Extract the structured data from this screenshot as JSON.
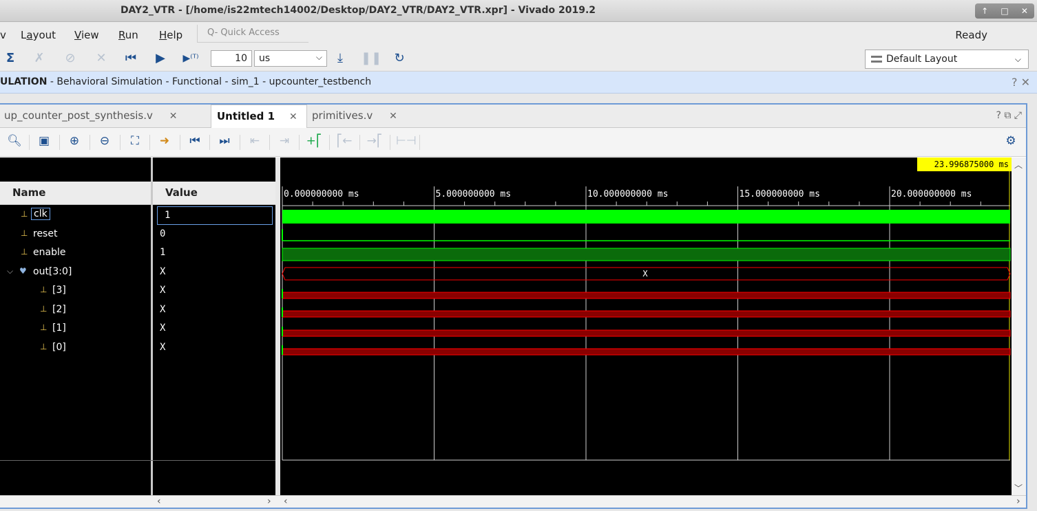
{
  "window": {
    "title": "DAY2_VTR - [/home/is22mtech14002/Desktop/DAY2_VTR/DAY2_VTR.xpr] - Vivado 2019.2",
    "controls": [
      "↑",
      "□",
      "✕"
    ]
  },
  "menu": {
    "items": [
      {
        "label": "Layout",
        "u": "a",
        "pre": "L",
        "post": "yout"
      },
      {
        "label": "View",
        "u": "V",
        "pre": "",
        "post": "iew"
      },
      {
        "label": "Run",
        "u": "R",
        "pre": "",
        "post": "un"
      },
      {
        "label": "Help",
        "u": "H",
        "pre": "",
        "post": "elp"
      }
    ],
    "quick_access": "Q- Quick Access",
    "status": "Ready",
    "partial_left": "v"
  },
  "toolbar": {
    "run_time": "10",
    "run_unit": "us",
    "layout": "Default Layout",
    "icons": [
      "sigma-icon",
      "step-back-icon",
      "run-all-icon",
      "run-for-icon",
      "restart-icon"
    ]
  },
  "sim_bar": {
    "title_bold": "ULATION",
    "title_rest": " - Behavioral Simulation - Functional - sim_1 - upcounter_testbench",
    "controls": "? ✕"
  },
  "tabs": [
    {
      "label": "up_counter_post_synthesis.v",
      "active": false
    },
    {
      "label": "Untitled 1",
      "active": true
    },
    {
      "label": "primitives.v",
      "active": false
    }
  ],
  "tab_controls": "?  ⧉  ⤢",
  "waveform": {
    "cursor_time": "23.996875000 ms",
    "headers": {
      "name": "Name",
      "value": "Value"
    },
    "time_axis": {
      "labels": [
        "0.000000000 ms",
        "5.000000000 ms",
        "10.000000000 ms",
        "15.000000000 ms",
        "20.000000000 ms"
      ],
      "ticks_ms": [
        0,
        5,
        10,
        15,
        20
      ]
    },
    "signals": [
      {
        "name": "clk",
        "value": "1",
        "indent": 0,
        "bus": false,
        "wave": "solid-green-high",
        "selected": true
      },
      {
        "name": "reset",
        "value": "0",
        "indent": 0,
        "bus": false,
        "wave": "low-green"
      },
      {
        "name": "enable",
        "value": "1",
        "indent": 0,
        "bus": false,
        "wave": "high-green"
      },
      {
        "name": "out[3:0]",
        "value": "X",
        "indent": 0,
        "bus": true,
        "expanded": true,
        "wave": "bus-x",
        "wave_label": "X"
      },
      {
        "name": "[3]",
        "value": "X",
        "indent": 1,
        "bus": false,
        "wave": "red-x"
      },
      {
        "name": "[2]",
        "value": "X",
        "indent": 1,
        "bus": false,
        "wave": "red-x"
      },
      {
        "name": "[1]",
        "value": "X",
        "indent": 1,
        "bus": false,
        "wave": "red-x"
      },
      {
        "name": "[0]",
        "value": "X",
        "indent": 1,
        "bus": false,
        "wave": "red-x"
      }
    ],
    "colors": {
      "logic_green": "#00ff00",
      "dark_green": "#0b6b0b",
      "x_red": "#ff0000",
      "cursor_yellow": "#ffff00",
      "bg": "#000000"
    }
  }
}
